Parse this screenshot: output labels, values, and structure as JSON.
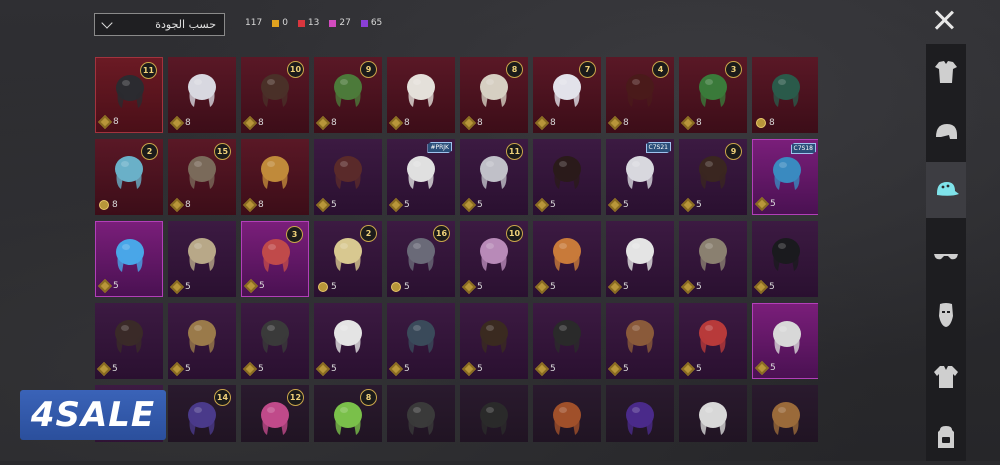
{
  "sort": {
    "label": "حسب الجودة"
  },
  "counts": [
    {
      "value": "117",
      "color": null
    },
    {
      "value": "0",
      "color": "#e0a21f"
    },
    {
      "value": "13",
      "color": "#d9363e"
    },
    {
      "value": "27",
      "color": "#d24bbf"
    },
    {
      "value": "65",
      "color": "#8a3fd6"
    }
  ],
  "categories": [
    {
      "name": "outfit",
      "icon": "outfit-icon",
      "active": false
    },
    {
      "name": "helmet",
      "icon": "helmet-icon",
      "active": false
    },
    {
      "name": "hat",
      "icon": "hat-icon",
      "active": true
    },
    {
      "name": "glasses",
      "icon": "glasses-icon",
      "active": false
    },
    {
      "name": "mask",
      "icon": "mask-icon",
      "active": false
    },
    {
      "name": "jacket",
      "icon": "jacket-icon",
      "active": false
    },
    {
      "name": "backpack",
      "icon": "backpack-icon",
      "active": false
    }
  ],
  "items": [
    [
      {
        "tier": "red",
        "level": "11",
        "points": "8",
        "art": "#2b2b30",
        "pt": "gem"
      },
      {
        "tier": "red2",
        "level": "",
        "points": "8",
        "art": "#d8d8e0",
        "pt": "gem"
      },
      {
        "tier": "red2",
        "level": "10",
        "points": "8",
        "art": "#4a3028",
        "pt": "gem"
      },
      {
        "tier": "red2",
        "level": "9",
        "points": "8",
        "art": "#4c7a3a",
        "pt": "gem"
      },
      {
        "tier": "red2",
        "level": "",
        "points": "8",
        "art": "#e4e0da",
        "pt": "gem"
      },
      {
        "tier": "red2",
        "level": "8",
        "points": "8",
        "art": "#d6cfc2",
        "pt": "gem"
      },
      {
        "tier": "red2",
        "level": "7",
        "points": "8",
        "art": "#e2e2ea",
        "pt": "gem"
      },
      {
        "tier": "red2",
        "level": "4",
        "points": "8",
        "art": "#4a1a1a",
        "pt": "gem"
      },
      {
        "tier": "red2",
        "level": "3",
        "points": "8",
        "art": "#3a7a3a",
        "pt": "gem"
      },
      {
        "tier": "red2",
        "level": "",
        "points": "8",
        "art": "#2a5a4a",
        "pt": "coin"
      }
    ],
    [
      {
        "tier": "red2",
        "level": "2",
        "points": "8",
        "art": "#6ab0c8",
        "pt": "coin"
      },
      {
        "tier": "red2",
        "level": "15",
        "points": "8",
        "art": "#7a6a5a",
        "pt": "gem"
      },
      {
        "tier": "red2",
        "level": "",
        "points": "8",
        "art": "#c08a3a",
        "pt": "gem"
      },
      {
        "tier": "purple",
        "level": "",
        "points": "5",
        "art": "#5a2a2a",
        "pt": "gem"
      },
      {
        "tier": "purple",
        "level": "",
        "points": "5",
        "art": "#e0e0e0",
        "pt": "gem",
        "code": "#PRJK"
      },
      {
        "tier": "purple",
        "level": "11",
        "points": "5",
        "art": "#c0c0c8",
        "pt": "gem"
      },
      {
        "tier": "purple",
        "level": "",
        "points": "5",
        "art": "#2a1a1a",
        "pt": "gem"
      },
      {
        "tier": "purple",
        "level": "",
        "points": "5",
        "art": "#d8d8de",
        "pt": "gem",
        "code": "C7S21"
      },
      {
        "tier": "purple",
        "level": "9",
        "points": "5",
        "art": "#3a2620",
        "pt": "gem"
      },
      {
        "tier": "pink",
        "level": "",
        "points": "5",
        "art": "#3a8ac0",
        "pt": "gem",
        "code": "C7S18"
      }
    ],
    [
      {
        "tier": "pink",
        "level": "",
        "points": "5",
        "art": "#49a6e8",
        "pt": "gem"
      },
      {
        "tier": "purple",
        "level": "",
        "points": "5",
        "art": "#b8a888",
        "pt": "gem"
      },
      {
        "tier": "pink",
        "level": "3",
        "points": "5",
        "art": "#c04a4a",
        "pt": "gem"
      },
      {
        "tier": "purple",
        "level": "2",
        "points": "5",
        "art": "#d8c890",
        "pt": "coin"
      },
      {
        "tier": "purple",
        "level": "16",
        "points": "5",
        "art": "#6a6a78",
        "pt": "coin"
      },
      {
        "tier": "purple",
        "level": "10",
        "points": "5",
        "art": "#b88ab8",
        "pt": "gem"
      },
      {
        "tier": "purple",
        "level": "",
        "points": "5",
        "art": "#c87a3a",
        "pt": "gem"
      },
      {
        "tier": "purple",
        "level": "",
        "points": "5",
        "art": "#e4e4e4",
        "pt": "gem"
      },
      {
        "tier": "purple",
        "level": "",
        "points": "5",
        "art": "#8a8070",
        "pt": "gem"
      },
      {
        "tier": "purple",
        "level": "",
        "points": "5",
        "art": "#1a1a1e",
        "pt": "gem"
      }
    ],
    [
      {
        "tier": "purple",
        "level": "",
        "points": "5",
        "art": "#3a2a28",
        "pt": "gem"
      },
      {
        "tier": "purple",
        "level": "",
        "points": "5",
        "art": "#9a7a4a",
        "pt": "gem"
      },
      {
        "tier": "purple",
        "level": "",
        "points": "5",
        "art": "#3a3a3a",
        "pt": "gem"
      },
      {
        "tier": "purple",
        "level": "",
        "points": "5",
        "art": "#e4e4e4",
        "pt": "gem"
      },
      {
        "tier": "purple",
        "level": "",
        "points": "5",
        "art": "#3a4a5a",
        "pt": "gem"
      },
      {
        "tier": "purple",
        "level": "",
        "points": "5",
        "art": "#3a2a20",
        "pt": "gem"
      },
      {
        "tier": "purple",
        "level": "",
        "points": "5",
        "art": "#2a2a2a",
        "pt": "gem"
      },
      {
        "tier": "purple",
        "level": "",
        "points": "5",
        "art": "#8a5a3a",
        "pt": "gem"
      },
      {
        "tier": "purple",
        "level": "",
        "points": "5",
        "art": "#b83a3a",
        "pt": "gem"
      },
      {
        "tier": "pink",
        "level": "",
        "points": "5",
        "art": "#d8d8d8",
        "pt": "gem"
      }
    ],
    [
      {
        "tier": "purple",
        "level": "",
        "points": "",
        "art": "#3a3a5a",
        "pt": ""
      },
      {
        "tier": "dark",
        "level": "14",
        "points": "",
        "art": "#4a3a8a",
        "pt": ""
      },
      {
        "tier": "dark",
        "level": "12",
        "points": "",
        "art": "#c04a8a",
        "pt": ""
      },
      {
        "tier": "dark",
        "level": "8",
        "points": "",
        "art": "#7ac04a",
        "pt": ""
      },
      {
        "tier": "dark",
        "level": "",
        "points": "",
        "art": "#3a3a3a",
        "pt": ""
      },
      {
        "tier": "dark",
        "level": "",
        "points": "",
        "art": "#2a2a2a",
        "pt": ""
      },
      {
        "tier": "dark",
        "level": "",
        "points": "",
        "art": "#a0502a",
        "pt": ""
      },
      {
        "tier": "dark",
        "level": "",
        "points": "",
        "art": "#4a2a8a",
        "pt": ""
      },
      {
        "tier": "dark",
        "level": "",
        "points": "",
        "art": "#d8d8d8",
        "pt": ""
      },
      {
        "tier": "dark",
        "level": "",
        "points": "",
        "art": "#9a6a3a",
        "pt": ""
      }
    ]
  ],
  "watermark": {
    "text": "4SALE"
  }
}
